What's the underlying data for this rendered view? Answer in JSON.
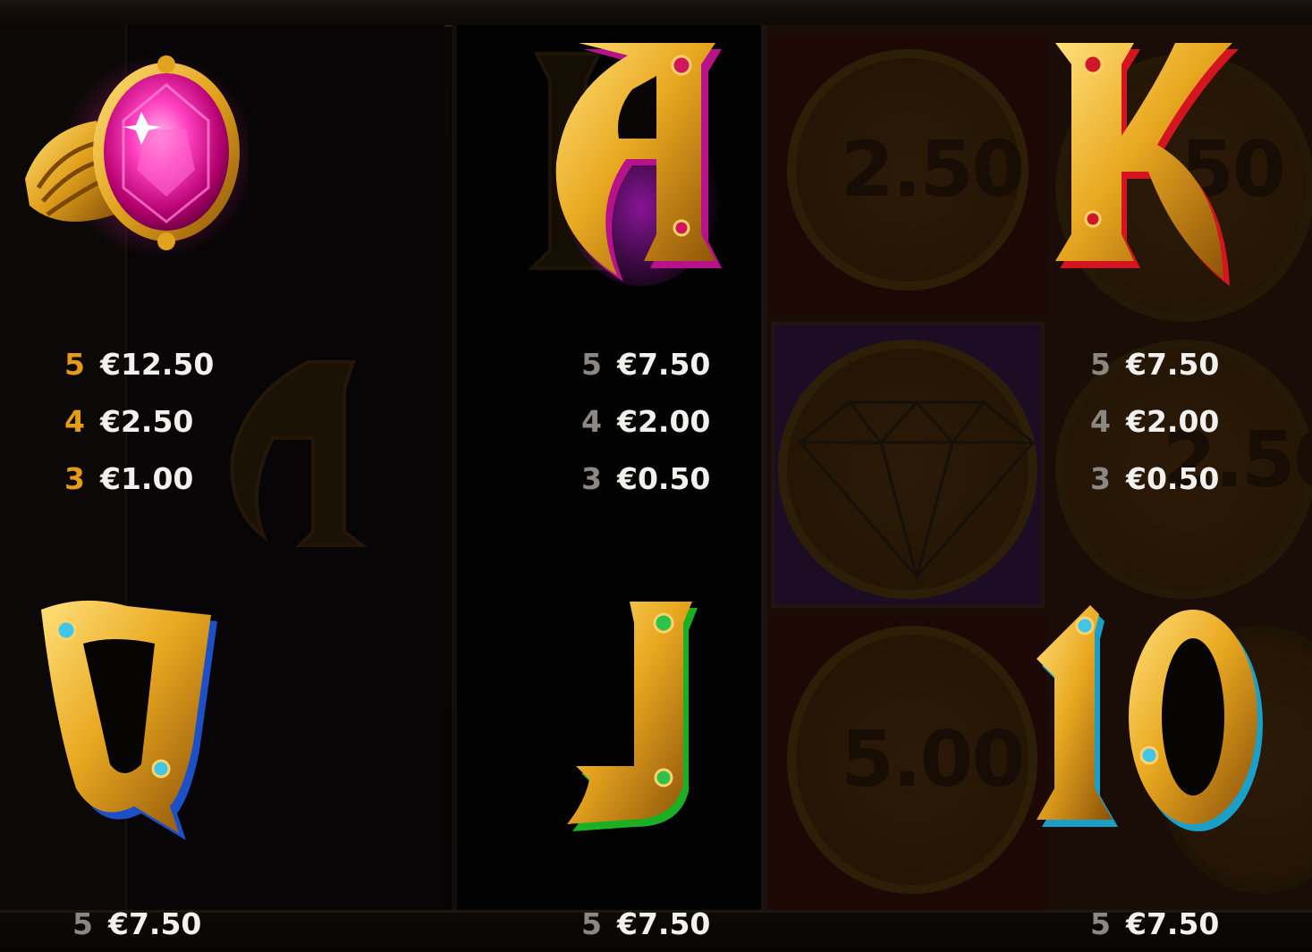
{
  "background": {
    "coin_values": [
      "2.50",
      "5.00",
      "2.50",
      "50"
    ]
  },
  "paytable": [
    {
      "symbol": "ruby-ring",
      "rows": [
        {
          "count": "5",
          "amount": "€12.50"
        },
        {
          "count": "4",
          "amount": "€2.50"
        },
        {
          "count": "3",
          "amount": "€1.00"
        }
      ]
    },
    {
      "symbol": "letter-a",
      "rows": [
        {
          "count": "5",
          "amount": "€7.50"
        },
        {
          "count": "4",
          "amount": "€2.00"
        },
        {
          "count": "3",
          "amount": "€0.50"
        }
      ]
    },
    {
      "symbol": "letter-k",
      "rows": [
        {
          "count": "5",
          "amount": "€7.50"
        },
        {
          "count": "4",
          "amount": "€2.00"
        },
        {
          "count": "3",
          "amount": "€0.50"
        }
      ]
    },
    {
      "symbol": "letter-q",
      "rows": [
        {
          "count": "5",
          "amount": "€7.50"
        }
      ]
    },
    {
      "symbol": "letter-j",
      "rows": [
        {
          "count": "5",
          "amount": "€7.50"
        }
      ]
    },
    {
      "symbol": "number-10",
      "rows": [
        {
          "count": "5",
          "amount": "€7.50"
        }
      ]
    }
  ],
  "colors": {
    "premium_count": "#e49b17",
    "standard_count": "#8b8782",
    "amount": "#f3f1ee",
    "gold": "#e2a21e"
  }
}
